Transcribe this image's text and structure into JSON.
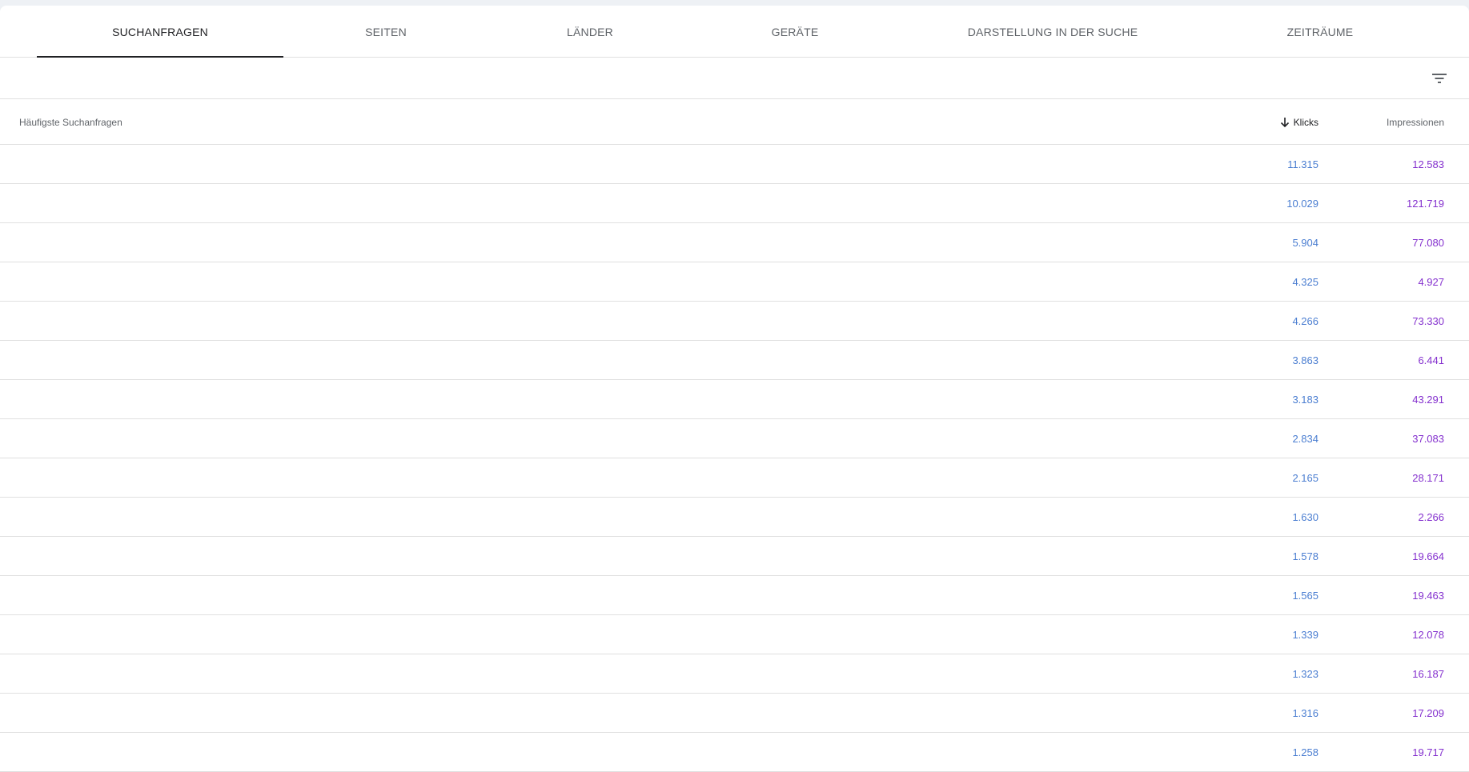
{
  "tabs": [
    {
      "label": "SUCHANFRAGEN"
    },
    {
      "label": "SEITEN"
    },
    {
      "label": "LÄNDER"
    },
    {
      "label": "GERÄTE"
    },
    {
      "label": "DARSTELLUNG IN DER SUCHE"
    },
    {
      "label": "ZEITRÄUME"
    }
  ],
  "active_tab": "SUCHANFRAGEN",
  "toolbar": {
    "filter_icon": "filter-icon"
  },
  "table": {
    "headers": {
      "query": "Häufigste Suchanfragen",
      "clicks": "Klicks",
      "impressions": "Impressionen"
    },
    "sort": {
      "column": "clicks",
      "direction": "descending",
      "icon": "arrow-down-icon"
    },
    "rows": [
      {
        "clicks": "11.315",
        "impressions": "12.583"
      },
      {
        "clicks": "10.029",
        "impressions": "121.719"
      },
      {
        "clicks": "5.904",
        "impressions": "77.080"
      },
      {
        "clicks": "4.325",
        "impressions": "4.927"
      },
      {
        "clicks": "4.266",
        "impressions": "73.330"
      },
      {
        "clicks": "3.863",
        "impressions": "6.441"
      },
      {
        "clicks": "3.183",
        "impressions": "43.291"
      },
      {
        "clicks": "2.834",
        "impressions": "37.083"
      },
      {
        "clicks": "2.165",
        "impressions": "28.171"
      },
      {
        "clicks": "1.630",
        "impressions": "2.266"
      },
      {
        "clicks": "1.578",
        "impressions": "19.664"
      },
      {
        "clicks": "1.565",
        "impressions": "19.463"
      },
      {
        "clicks": "1.339",
        "impressions": "12.078"
      },
      {
        "clicks": "1.323",
        "impressions": "16.187"
      },
      {
        "clicks": "1.316",
        "impressions": "17.209"
      },
      {
        "clicks": "1.258",
        "impressions": "19.717"
      }
    ]
  },
  "colors": {
    "clicks": "#4b7ed1",
    "impressions": "#8430ce",
    "active_tab_indicator": "#202124"
  }
}
